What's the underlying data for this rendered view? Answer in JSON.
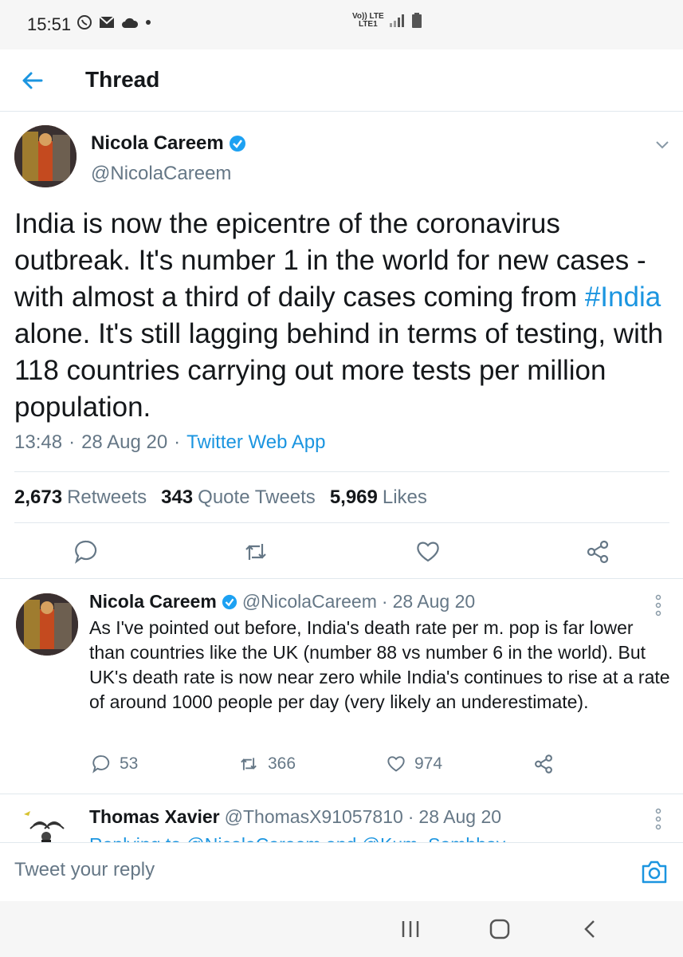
{
  "status_bar": {
    "time": "15:51",
    "network_top": "Vo)) LTE",
    "network_bottom": "LTE1"
  },
  "header": {
    "title": "Thread",
    "back_icon": "back-arrow-icon"
  },
  "main_tweet": {
    "name": "Nicola Careem",
    "handle": "@NicolaCareem",
    "text_before": "India is now the epicentre of the coronavirus outbreak.  It's number 1 in the world for new cases - with almost a third of daily cases coming from ",
    "hashtag": "#India",
    "text_after": " alone.  It's still lagging behind in terms of testing, with 118 countries carrying out more tests per million population.",
    "time": "13:48",
    "sep1": "·",
    "date": "28 Aug 20",
    "sep2": "·",
    "source": "Twitter Web App",
    "retweets_count": "2,673",
    "retweets_label": "Retweets",
    "quotes_count": "343",
    "quotes_label": "Quote Tweets",
    "likes_count": "5,969",
    "likes_label": "Likes"
  },
  "reply_tweet": {
    "name": "Nicola Careem",
    "handle": "@NicolaCareem",
    "sep": "·",
    "date": "28 Aug 20",
    "text": "As I've pointed out before, India's death rate per m. pop is far lower than countries like the UK (number 88 vs number 6 in the world). But UK's death rate is now near zero while India's continues to rise at a rate of around 1000 people per day (very likely an underestimate).",
    "replies": "53",
    "retweets": "366",
    "likes": "974"
  },
  "third_tweet": {
    "name": "Thomas Xavier",
    "handle": "@ThomasX91057810",
    "sep": "·",
    "date": "28 Aug 20",
    "replying_to": "Replying to @NicolaCareem and @Kum_Sambhav"
  },
  "reply_bar": {
    "placeholder": "Tweet your reply"
  },
  "colors": {
    "accent": "#1b95e0",
    "secondary_text": "#657786",
    "divider": "#e1e8ed"
  }
}
